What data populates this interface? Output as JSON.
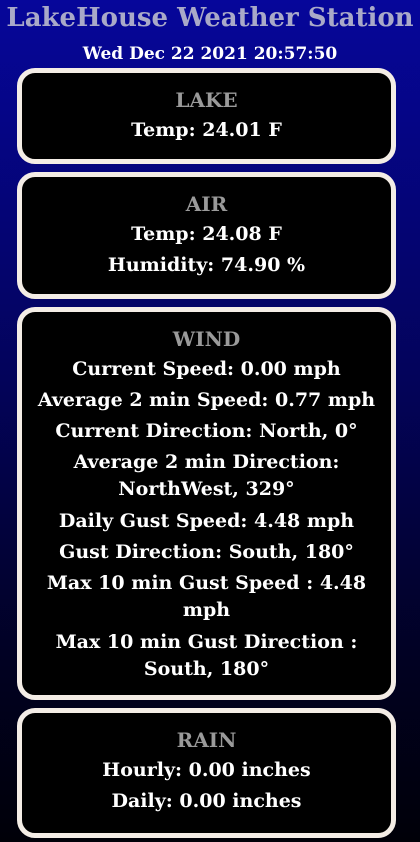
{
  "header": {
    "title": "LakeHouse Weather Station",
    "datetime": "Wed Dec 22 2021 20:57:50"
  },
  "lake": {
    "heading": "LAKE",
    "temp": "Temp: 24.01 F"
  },
  "air": {
    "heading": "AIR",
    "temp": "Temp: 24.08 F",
    "humidity": "Humidity: 74.90 %"
  },
  "wind": {
    "heading": "WIND",
    "current_speed": "Current Speed: 0.00 mph",
    "avg_2min_speed": "Average 2 min Speed: 0.77 mph",
    "current_direction": "Current Direction: North, 0°",
    "avg_2min_direction": "Average 2 min Direction: NorthWest, 329°",
    "daily_gust_speed": "Daily Gust Speed: 4.48 mph",
    "gust_direction": "Gust Direction: South, 180°",
    "max_10min_gust_speed": "Max 10 min Gust Speed : 4.48 mph",
    "max_10min_gust_direction": "Max 10 min Gust Direction : South, 180°"
  },
  "rain": {
    "heading": "RAIN",
    "hourly": "Hourly: 0.00 inches",
    "daily": "Daily: 0.00 inches"
  },
  "colors": {
    "background_top": "#06069a",
    "background_bottom": "#000008",
    "card_background": "#000000",
    "card_border": "#f4ede6",
    "title_text": "#a9a9c8",
    "heading_text": "#9a9a9a",
    "value_text": "#ffffff"
  }
}
